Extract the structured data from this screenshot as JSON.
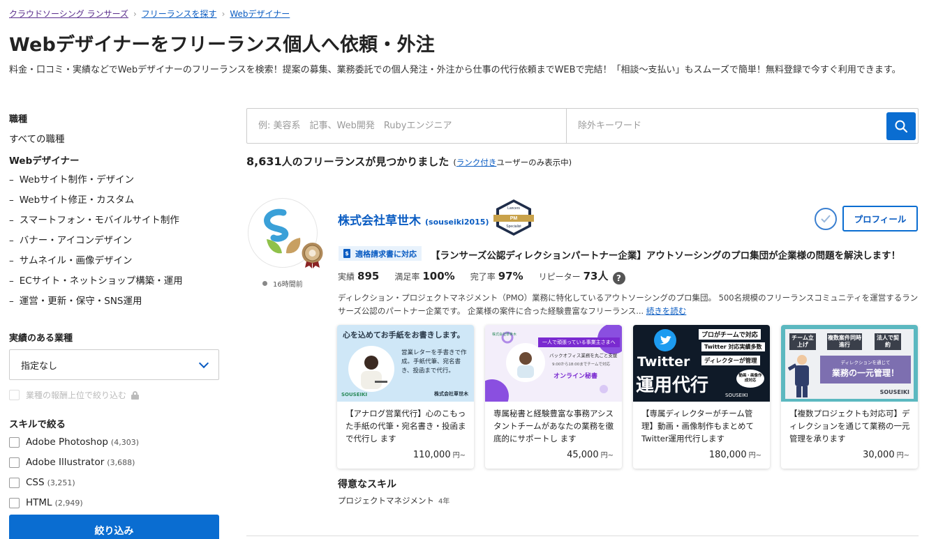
{
  "breadcrumb": [
    {
      "label": "クラウドソーシング ランサーズ"
    },
    {
      "label": "フリーランスを探す"
    },
    {
      "label": "Webデザイナー"
    }
  ],
  "page": {
    "title": "Webデザイナーをフリーランス個人へ依頼・外注",
    "description": "料金・口コミ・実績などでWebデザイナーのフリーランスを検索！提案の募集、業務委託での個人発注・外注から仕事の代行依頼までWEBで完結！「相談〜支払い」もスムーズで簡単！無料登録で今すぐ利用できます。"
  },
  "sidebar": {
    "job_heading": "職種",
    "all_jobs": "すべての職種",
    "category": "Webデザイナー",
    "sub_items": [
      "Webサイト制作・デザイン",
      "Webサイト修正・カスタム",
      "スマートフォン・モバイルサイト制作",
      "バナー・アイコンデザイン",
      "サムネイル・画像デザイン",
      "ECサイト・ネットショップ構築・運用",
      "運営・更新・保守・SNS運用"
    ],
    "dash": "–",
    "industry_heading": "実績のある業種",
    "industry_select": "指定なし",
    "reward_filter": "業種の報酬上位で絞り込む",
    "skills_heading": "スキルで絞る",
    "skills": [
      {
        "name": "Adobe Photoshop",
        "count": "(4,303)"
      },
      {
        "name": "Adobe Illustrator",
        "count": "(3,688)"
      },
      {
        "name": "CSS",
        "count": "(3,251)"
      },
      {
        "name": "HTML",
        "count": "(2,949)"
      }
    ],
    "filter_button": "絞り込み"
  },
  "search": {
    "keyword_placeholder": "例: 美容系　記事、Web開発　Rubyエンジニア",
    "exclude_placeholder": "除外キーワード"
  },
  "results": {
    "count": "8,631",
    "suffix": " 人のフリーランスが見つかりました",
    "paren_open": "(",
    "rank_link": "ランク付き",
    "paren_rest": "ユーザーのみ表示中)"
  },
  "card": {
    "company_name": "株式会社草世木",
    "user_id": "(souseiki2015)",
    "badge_top": "Lancers",
    "badge_mid": "PM",
    "badge_bottom": "Specialist",
    "last_online": "16時間前",
    "profile_button": "プロフィール",
    "invoice_tag": "適格請求書に対応",
    "catchcopy": "【ランサーズ公認ディレクションパートナー企業】アウトソーシングのプロ集団が企業様の問題を解決します！",
    "stats": [
      {
        "label": "実績",
        "value": "895"
      },
      {
        "label": "満足率",
        "value": "100%"
      },
      {
        "label": "完了率",
        "value": "97%"
      },
      {
        "label": "リピーター",
        "value": "73人"
      }
    ],
    "help": "?",
    "intro": "ディレクション・プロジェクトマネジメント（PMO）業務に特化しているアウトソーシングのプロ集団。 500名規模のフリーランスコミュニティを運営するランサーズ公認のパートナー企業です。 企業様の案件に合った経験豊富なフリーランス...",
    "read_more": "続きを読む",
    "works": [
      {
        "title": "【アナログ営業代行】心のこもった手紙の代筆・宛名書き・投函まで代行し ます",
        "price": "110,000",
        "yen": "円~",
        "thumb_head": "心を込めてお手紙をお書きします。",
        "thumb_body": "営業レターを手書きで作成。手紙代筆、宛名書き、投函まで代行。",
        "thumb_foot": "株式会社草世木",
        "thumb_logo": "SOUSEIKI"
      },
      {
        "title": "専属秘書と経験豊富な事務アシスタントチームがあなたの業務を徹底的にサポートし ます",
        "price": "45,000",
        "yen": "円~",
        "thumb_head": "一人で頑張っている事業主さまへ",
        "thumb_body": "バックオフィス業務を丸ごと支援",
        "thumb_sub": "9:00から18:00までチームで対応",
        "thumb_foot": "オンライン秘書",
        "thumb_logo": "株式会社草世木"
      },
      {
        "title": "【専属ディレクターがチーム管理】動画・画像制作もまとめて Twitter運用代行します",
        "price": "180,000",
        "yen": "円~",
        "thumb_l1": "プロがチームで対応",
        "thumb_l2": "Twitter 対応実績多数",
        "thumb_l3": "ディレクターが管理",
        "thumb_big1": "Twitter",
        "thumb_big2": "運用代行",
        "thumb_bubble": "動画・画像作成対応",
        "thumb_logo": "SOUSEIKI"
      },
      {
        "title": "【複数プロジェクトも対応可】ディレクションを通じて業務の一元管理を承ります",
        "price": "30,000",
        "yen": "円~",
        "thumb_t1": "チーム立上げ",
        "thumb_t2": "複数案件同時進行",
        "thumb_t3": "法人で契約",
        "thumb_sub": "ディレクションを通じて",
        "thumb_main": "業務の一元管理！",
        "thumb_logo": "SOUSEIKI"
      }
    ],
    "skills_heading": "得意なスキル",
    "skill": "プロジェクトマネジメント",
    "skill_years": "4年"
  },
  "colors": {
    "primary": "#0a6dd1",
    "link": "#0a5cc2",
    "invoice_bg": "#e8f2fc"
  }
}
